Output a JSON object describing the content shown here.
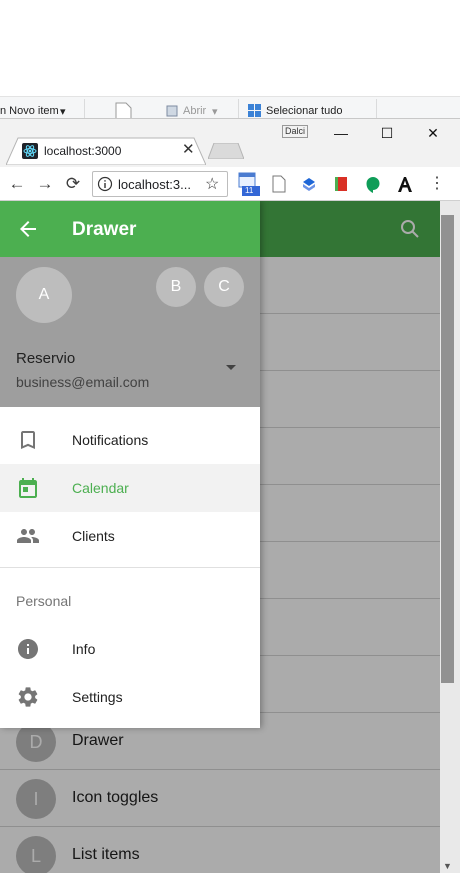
{
  "explorer_ribbon": {
    "new_item": "n Novo item",
    "open": "Abrir",
    "select_all": "Selecionar tudo"
  },
  "browser": {
    "profile_name": "Dalci",
    "tab": {
      "title": "localhost:3000",
      "icon": "react-icon"
    },
    "window_controls": {
      "minimize": "—",
      "maximize": "☐",
      "close": "✕"
    },
    "nav": {
      "back": "←",
      "forward": "→",
      "reload": "⟳"
    },
    "omnibox": {
      "url": "localhost:3...",
      "star": "☆"
    },
    "extensions": [
      {
        "icon": "calendar-extension-icon",
        "badge": "11"
      },
      {
        "icon": "document-extension-icon"
      },
      {
        "icon": "dropbox-icon"
      },
      {
        "icon": "book-extension-icon"
      },
      {
        "icon": "hangouts-icon"
      },
      {
        "icon": "font-a-icon"
      }
    ],
    "menu": "⋮"
  },
  "app": {
    "appbar_color": "#4caf50",
    "background_list": [
      {
        "avatar": "",
        "label": ""
      },
      {
        "avatar": "",
        "label": ""
      },
      {
        "avatar": "",
        "label": ""
      },
      {
        "avatar": "",
        "label": ""
      },
      {
        "avatar": "",
        "label": ""
      },
      {
        "avatar": "",
        "label": ""
      },
      {
        "avatar": "",
        "label": ""
      },
      {
        "avatar": "",
        "label": ""
      },
      {
        "avatar": "D",
        "label": "Drawer"
      },
      {
        "avatar": "I",
        "label": "Icon toggles"
      },
      {
        "avatar": "L",
        "label": "List items"
      }
    ]
  },
  "drawer": {
    "title": "Drawer",
    "accent": "#4caf50",
    "account": {
      "primary_avatar": "A",
      "other_avatars": [
        "B",
        "C"
      ],
      "name": "Reservio",
      "email": "business@email.com"
    },
    "items": [
      {
        "label": "Notifications",
        "icon": "bookmark-icon",
        "selected": false
      },
      {
        "label": "Calendar",
        "icon": "calendar-icon",
        "selected": true
      },
      {
        "label": "Clients",
        "icon": "people-icon",
        "selected": false
      }
    ],
    "subheader": "Personal",
    "personal_items": [
      {
        "label": "Info",
        "icon": "info-icon"
      },
      {
        "label": "Settings",
        "icon": "gear-icon"
      }
    ]
  }
}
